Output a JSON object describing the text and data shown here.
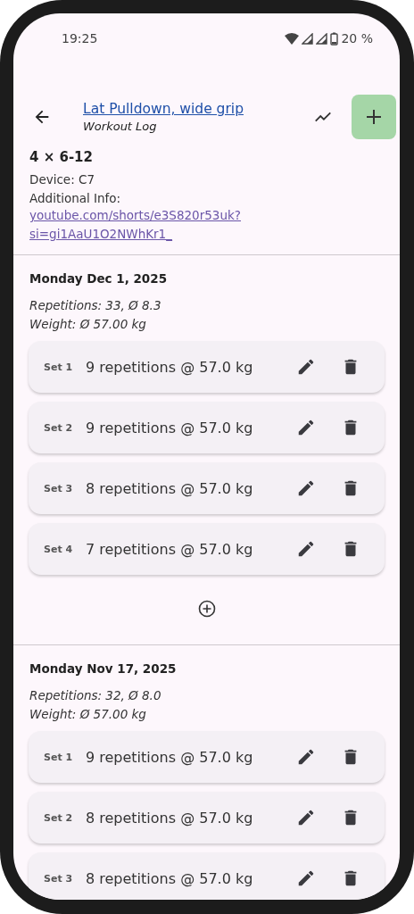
{
  "status_bar": {
    "time": "19:25",
    "battery": "20 %"
  },
  "app_bar": {
    "title": "Lat Pulldown, wide grip",
    "subtitle": "Workout Log"
  },
  "exercise": {
    "scheme": "4 × 6-12",
    "device": "Device: C7",
    "info_label": "Additional Info:",
    "info_link_lines": [
      "youtube.com/shorts/e3S820r53uk?",
      "si=gi1AaU1O2NWhKr1_"
    ]
  },
  "sessions": [
    {
      "date": "Monday Dec 1, 2025",
      "repetitions": "Repetitions: 33, Ø 8.3",
      "weight": "Weight: Ø 57.00 kg",
      "sets": [
        {
          "label": "Set 1",
          "text": "9 repetitions @ 57.0 kg"
        },
        {
          "label": "Set 2",
          "text": "9 repetitions @ 57.0 kg"
        },
        {
          "label": "Set 3",
          "text": "8 repetitions @ 57.0 kg"
        },
        {
          "label": "Set 4",
          "text": "7 repetitions @ 57.0 kg"
        }
      ]
    },
    {
      "date": "Monday Nov 17, 2025",
      "repetitions": "Repetitions: 32, Ø 8.0",
      "weight": "Weight: Ø 57.00 kg",
      "sets": [
        {
          "label": "Set 1",
          "text": "9 repetitions @ 57.0 kg"
        },
        {
          "label": "Set 2",
          "text": "8 repetitions @ 57.0 kg"
        },
        {
          "label": "Set 3",
          "text": "8 repetitions @ 57.0 kg"
        }
      ]
    }
  ]
}
